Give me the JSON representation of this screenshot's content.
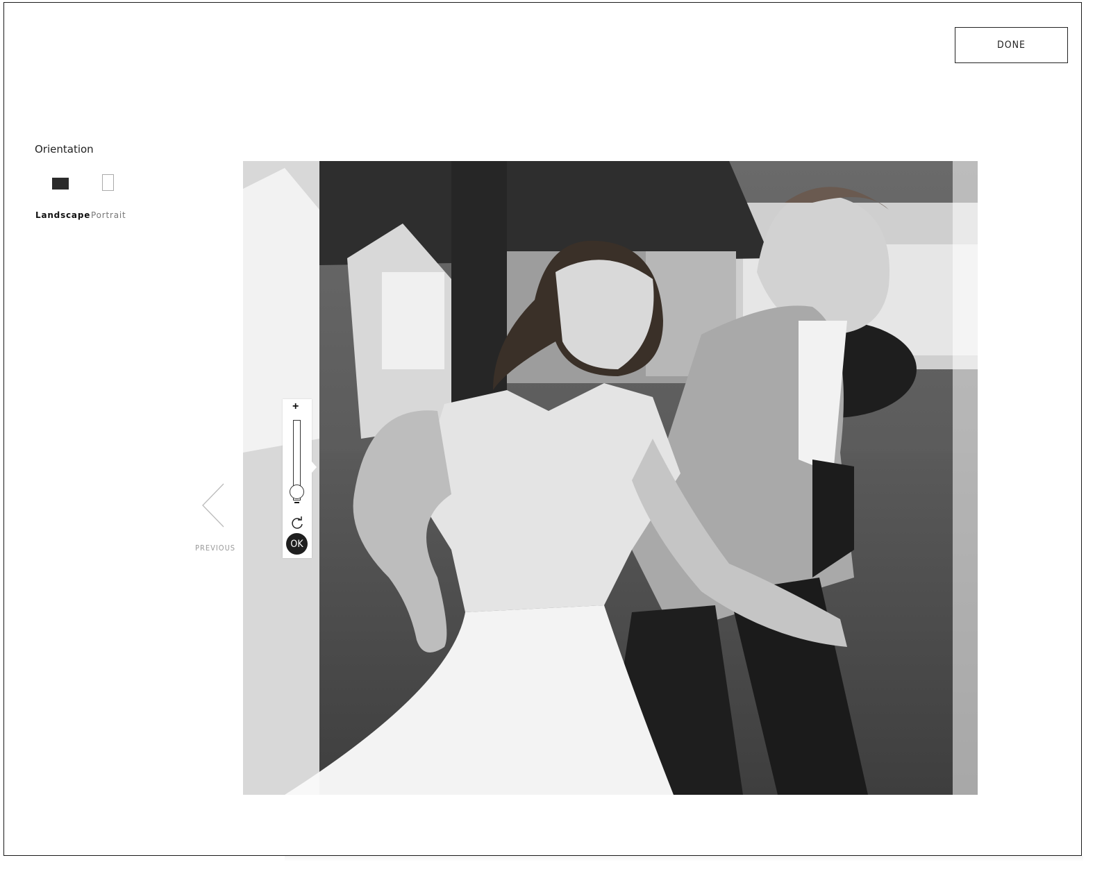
{
  "toolbar": {
    "done_label": "DONE"
  },
  "orientation": {
    "title": "Orientation",
    "options": [
      {
        "label": "Landscape",
        "selected": true
      },
      {
        "label": "Portrait",
        "selected": false
      }
    ]
  },
  "navigation": {
    "previous_label": "PREVIOUS"
  },
  "zoom": {
    "plus_label": "+",
    "ok_label": "OK",
    "level": 0.1
  },
  "colors": {
    "accent": "#1f1f1f",
    "border": "#222222",
    "muted": "#999999"
  }
}
